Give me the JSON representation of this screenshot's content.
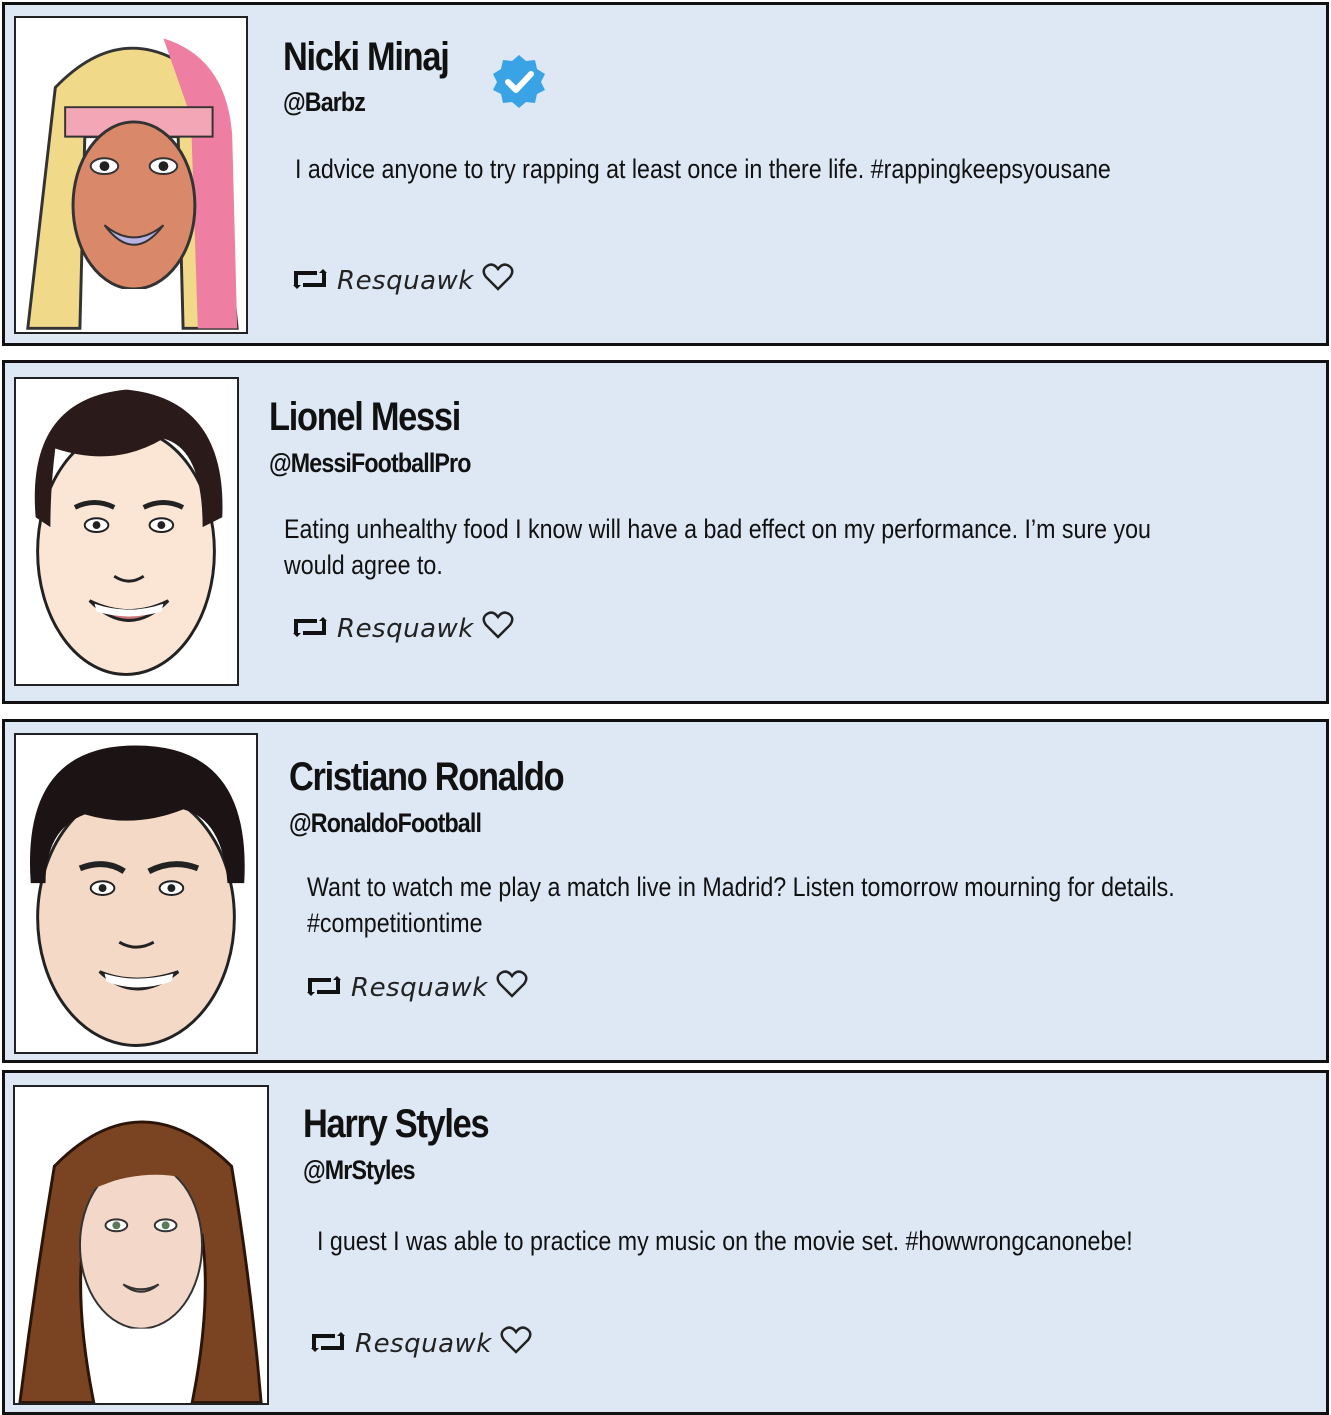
{
  "posts": [
    {
      "name": "Nicki Minaj",
      "handle": "@Barbz",
      "text": "I advice anyone to try rapping at least once in there life. #rappingkeepsyousane",
      "verified": true,
      "action_label": "Resquawk",
      "avatar_icon": "nicki-minaj-avatar"
    },
    {
      "name": "Lionel Messi",
      "handle": "@MessiFootballPro",
      "text": "Eating unhealthy food I know will have a bad effect on my performance. I’m sure you would agree to.",
      "verified": false,
      "action_label": "Resquawk",
      "avatar_icon": "lionel-messi-avatar"
    },
    {
      "name": "Cristiano Ronaldo",
      "handle": "@RonaldoFootball",
      "text": "Want to watch me play a match live in Madrid? Listen tomorrow mourning for details. #competitiontime",
      "verified": false,
      "action_label": "Resquawk",
      "avatar_icon": "cristiano-ronaldo-avatar"
    },
    {
      "name": "Harry Styles",
      "handle": "@MrStyles",
      "text": "I guest I was able to practice my music on the movie set. #howwrongcanonebe!",
      "verified": false,
      "action_label": "Resquawk",
      "avatar_icon": "harry-styles-avatar"
    }
  ],
  "colors": {
    "card_background": "#dde8f4",
    "border": "#111111",
    "verified_badge": "#3aa3e6"
  }
}
